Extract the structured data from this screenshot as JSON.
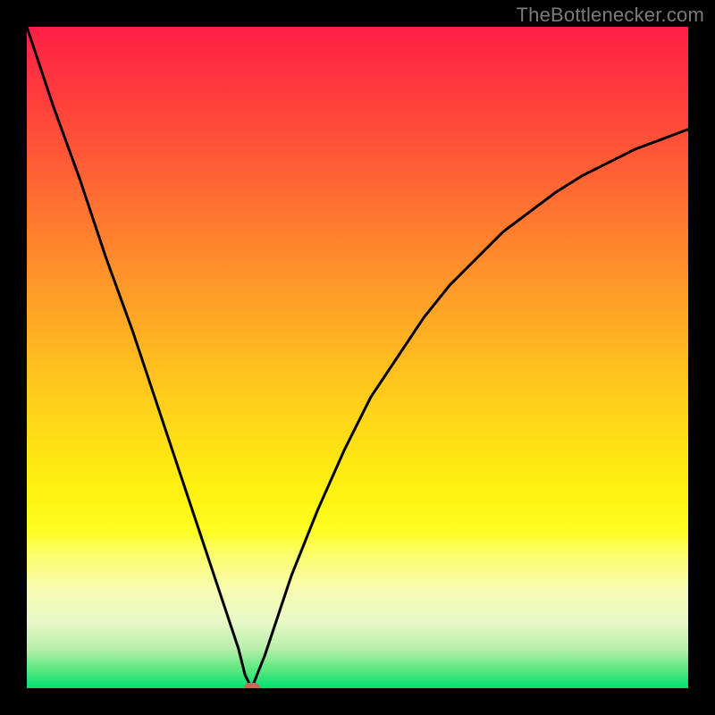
{
  "watermark": {
    "text": "TheBottlenecker.com"
  },
  "chart_data": {
    "type": "line",
    "title": "",
    "xlabel": "",
    "ylabel": "",
    "xlim": [
      0,
      100
    ],
    "ylim": [
      0,
      100
    ],
    "optimum_x": 34,
    "marker": {
      "x": 34,
      "y": 0,
      "color": "#c46a5a"
    },
    "series": [
      {
        "name": "left-branch",
        "x": [
          0,
          4,
          8,
          12,
          16,
          20,
          24,
          28,
          30,
          32,
          33,
          34
        ],
        "y": [
          100,
          88,
          77,
          65,
          54,
          42,
          30,
          18,
          12,
          6,
          2,
          0
        ]
      },
      {
        "name": "right-branch",
        "x": [
          34,
          36,
          38,
          40,
          44,
          48,
          52,
          56,
          60,
          64,
          68,
          72,
          76,
          80,
          84,
          88,
          92,
          96,
          100
        ],
        "y": [
          0,
          5,
          11,
          17,
          27,
          36,
          44,
          50,
          56,
          61,
          65,
          69,
          72,
          75,
          77.5,
          79.5,
          81.5,
          83,
          84.5
        ]
      }
    ],
    "gradient_stops": [
      {
        "pos": 0,
        "color": "#ff1f44"
      },
      {
        "pos": 50,
        "color": "#ffd818"
      },
      {
        "pos": 80,
        "color": "#fcfd70"
      },
      {
        "pos": 100,
        "color": "#00e070"
      }
    ]
  }
}
